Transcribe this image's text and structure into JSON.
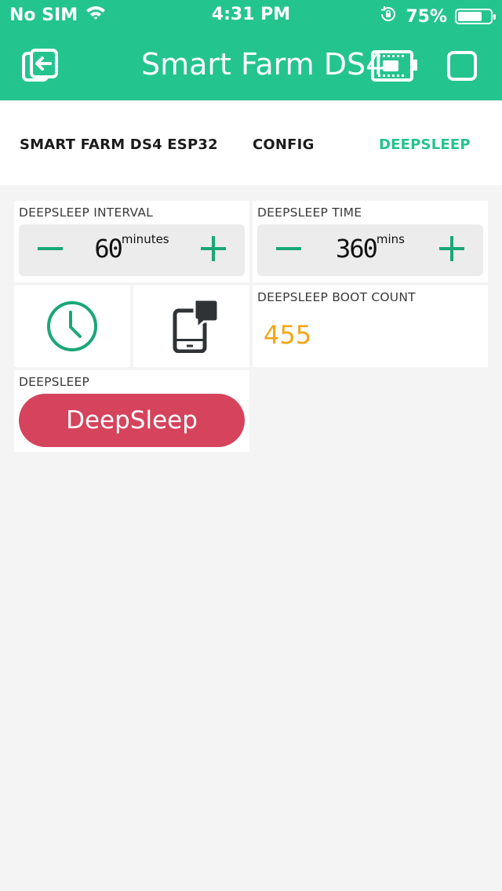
{
  "status_bar": {
    "carrier": "No SIM",
    "time": "4:31 PM",
    "battery_percent": "75%",
    "battery_level": 0.75
  },
  "header": {
    "title": "Smart Farm DS4",
    "background_color": "#24c48e",
    "left_icon": "exit-icon",
    "right_icons": [
      "device-board-icon",
      "stop-square-icon"
    ]
  },
  "tabs": [
    {
      "label": "SMART FARM DS4 ESP32",
      "active": false
    },
    {
      "label": "CONFIG",
      "active": false
    },
    {
      "label": "DEEPSLEEP",
      "active": true
    }
  ],
  "widgets": {
    "interval": {
      "label": "DEEPSLEEP INTERVAL",
      "value": "60",
      "unit": "minutes"
    },
    "time": {
      "label": "DEEPSLEEP TIME",
      "value": "360",
      "unit": "mins"
    },
    "timer_icon": "clock-icon",
    "device_icon": "phone-notification-icon",
    "boot_count": {
      "label": "DEEPSLEEP BOOT COUNT",
      "value": "455",
      "color": "#f2a516"
    },
    "deepsleep": {
      "label": "DEEPSLEEP",
      "button_label": "DeepSleep",
      "color": "#d5435c"
    }
  }
}
